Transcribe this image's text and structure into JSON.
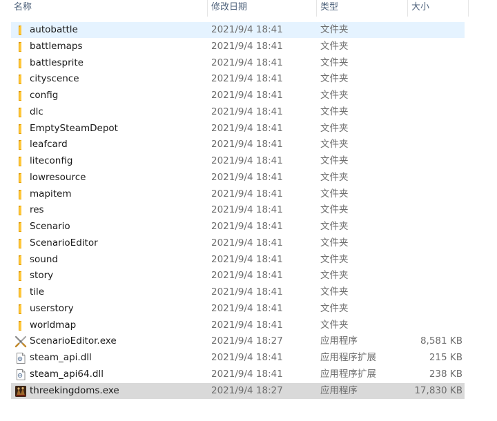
{
  "columns": {
    "name": "名称",
    "date": "修改日期",
    "type": "类型",
    "size": "大小"
  },
  "files": [
    {
      "name": "autobattle",
      "date": "2021/9/4 18:41",
      "type": "文件夹",
      "size": "",
      "icon": "folder-icon",
      "state": "hover"
    },
    {
      "name": "battlemaps",
      "date": "2021/9/4 18:41",
      "type": "文件夹",
      "size": "",
      "icon": "folder-icon"
    },
    {
      "name": "battlesprite",
      "date": "2021/9/4 18:41",
      "type": "文件夹",
      "size": "",
      "icon": "folder-icon"
    },
    {
      "name": "cityscence",
      "date": "2021/9/4 18:41",
      "type": "文件夹",
      "size": "",
      "icon": "folder-icon"
    },
    {
      "name": "config",
      "date": "2021/9/4 18:41",
      "type": "文件夹",
      "size": "",
      "icon": "folder-icon"
    },
    {
      "name": "dlc",
      "date": "2021/9/4 18:41",
      "type": "文件夹",
      "size": "",
      "icon": "folder-icon"
    },
    {
      "name": "EmptySteamDepot",
      "date": "2021/9/4 18:41",
      "type": "文件夹",
      "size": "",
      "icon": "folder-icon"
    },
    {
      "name": "leafcard",
      "date": "2021/9/4 18:41",
      "type": "文件夹",
      "size": "",
      "icon": "folder-icon"
    },
    {
      "name": "liteconfig",
      "date": "2021/9/4 18:41",
      "type": "文件夹",
      "size": "",
      "icon": "folder-icon"
    },
    {
      "name": "lowresource",
      "date": "2021/9/4 18:41",
      "type": "文件夹",
      "size": "",
      "icon": "folder-icon"
    },
    {
      "name": "mapitem",
      "date": "2021/9/4 18:41",
      "type": "文件夹",
      "size": "",
      "icon": "folder-icon"
    },
    {
      "name": "res",
      "date": "2021/9/4 18:41",
      "type": "文件夹",
      "size": "",
      "icon": "folder-icon"
    },
    {
      "name": "Scenario",
      "date": "2021/9/4 18:41",
      "type": "文件夹",
      "size": "",
      "icon": "folder-icon"
    },
    {
      "name": "ScenarioEditor",
      "date": "2021/9/4 18:41",
      "type": "文件夹",
      "size": "",
      "icon": "folder-icon"
    },
    {
      "name": "sound",
      "date": "2021/9/4 18:41",
      "type": "文件夹",
      "size": "",
      "icon": "folder-icon"
    },
    {
      "name": "story",
      "date": "2021/9/4 18:41",
      "type": "文件夹",
      "size": "",
      "icon": "folder-icon"
    },
    {
      "name": "tile",
      "date": "2021/9/4 18:41",
      "type": "文件夹",
      "size": "",
      "icon": "folder-icon"
    },
    {
      "name": "userstory",
      "date": "2021/9/4 18:41",
      "type": "文件夹",
      "size": "",
      "icon": "folder-icon"
    },
    {
      "name": "worldmap",
      "date": "2021/9/4 18:41",
      "type": "文件夹",
      "size": "",
      "icon": "folder-icon"
    },
    {
      "name": "ScenarioEditor.exe",
      "date": "2021/9/4 18:27",
      "type": "应用程序",
      "size": "8,581 KB",
      "icon": "crossed-swords-exe-icon"
    },
    {
      "name": "steam_api.dll",
      "date": "2021/9/4 18:41",
      "type": "应用程序扩展",
      "size": "215 KB",
      "icon": "dll-file-icon"
    },
    {
      "name": "steam_api64.dll",
      "date": "2021/9/4 18:41",
      "type": "应用程序扩展",
      "size": "238 KB",
      "icon": "dll-file-icon"
    },
    {
      "name": "threekingdoms.exe",
      "date": "2021/9/4 18:27",
      "type": "应用程序",
      "size": "17,830 KB",
      "icon": "game-exe-icon",
      "state": "selected"
    }
  ],
  "colors": {
    "hover": "#e5f3ff",
    "selected": "#d9d9d9",
    "folder": "#ffc83d",
    "header_text": "#4c607a"
  }
}
